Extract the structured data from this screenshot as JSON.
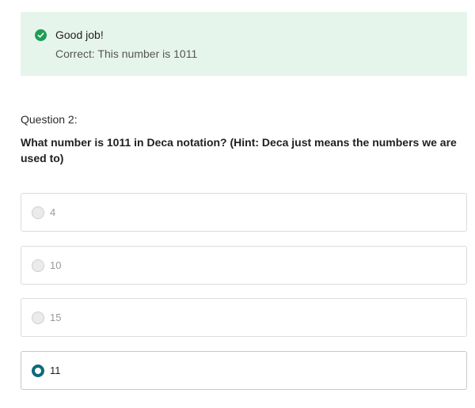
{
  "feedback": {
    "icon": "check-circle-icon",
    "title": "Good job!",
    "detail": "Correct: This number is 1011",
    "color": "#1f9d55",
    "background": "#e6f5ec"
  },
  "question": {
    "label": "Question 2:",
    "text": "What number is 1011 in Deca notation? (Hint: Deca just means the numbers we are used to)"
  },
  "options": [
    {
      "label": "4",
      "selected": false
    },
    {
      "label": "10",
      "selected": false
    },
    {
      "label": "15",
      "selected": false
    },
    {
      "label": "11",
      "selected": true
    }
  ],
  "accent_color": "#0b6b7a"
}
